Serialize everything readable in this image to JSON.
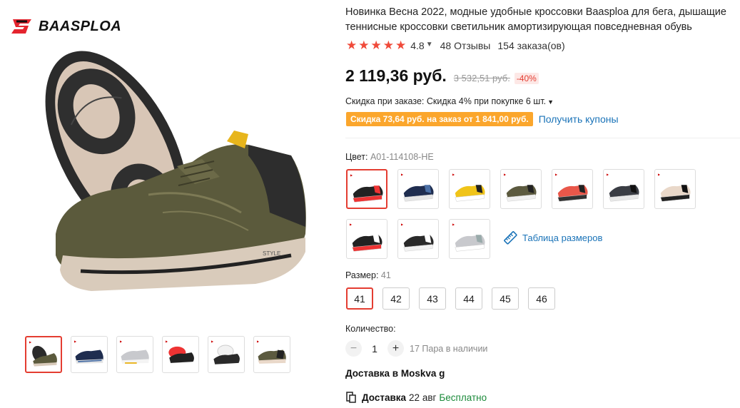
{
  "brand": {
    "name": "BAASPLOA"
  },
  "product": {
    "title": "Новинка Весна 2022, модные удобные кроссовки Baasploa для бега, дышащие теннисные кроссовки светильник амортизирующая повседневная обувь",
    "rating": "4.8",
    "reviews": "48 Отзывы",
    "orders": "154 заказа(ов)",
    "price": "2 119,36 руб.",
    "old_price": "3 532,51 руб.",
    "discount": "-40%",
    "order_discount": "Скидка при заказе: Скидка 4% при покупке 6 шт.",
    "coupon_badge": "Скидка 73,64 руб. на заказ от 1 841,00 руб.",
    "coupon_link": "Получить купоны"
  },
  "gallery": {
    "thumbs": [
      {
        "name": "olive"
      },
      {
        "name": "navy"
      },
      {
        "name": "grey"
      },
      {
        "name": "black-red"
      },
      {
        "name": "black-white"
      },
      {
        "name": "olive-2"
      }
    ]
  },
  "color": {
    "label": "Цвет:",
    "selected": "A01-114108-HE",
    "swatches": [
      {
        "name": "black-red",
        "upper": "#222",
        "sole": "#e33",
        "accent": "#e33"
      },
      {
        "name": "navy",
        "upper": "#1f2d4f",
        "sole": "#e6e6e6",
        "accent": "#4a6fa5"
      },
      {
        "name": "yellow",
        "upper": "#f0c419",
        "sole": "#fff",
        "accent": "#222"
      },
      {
        "name": "olive",
        "upper": "#5c5a3f",
        "sole": "#f0f0f0",
        "accent": "#222"
      },
      {
        "name": "coral",
        "upper": "#e9574a",
        "sole": "#333",
        "accent": "#222"
      },
      {
        "name": "dark-grey",
        "upper": "#3a3d44",
        "sole": "#e8e8e8",
        "accent": "#111"
      },
      {
        "name": "beige",
        "upper": "#e9d8c9",
        "sole": "#222",
        "accent": "#111"
      },
      {
        "name": "black-white-red",
        "upper": "#222",
        "sole": "#e33",
        "accent": "#fff"
      },
      {
        "name": "black-white",
        "upper": "#2a2a2a",
        "sole": "#f2f2f2",
        "accent": "#fff"
      },
      {
        "name": "light-grey",
        "upper": "#c8c9cd",
        "sole": "#fff",
        "accent": "#9aa"
      }
    ],
    "size_chart": "Таблица размеров"
  },
  "size": {
    "label": "Размер:",
    "selected": "41",
    "options": [
      "41",
      "42",
      "43",
      "44",
      "45",
      "46"
    ]
  },
  "quantity": {
    "label": "Количество:",
    "value": "1",
    "minus": "−",
    "plus": "+",
    "stock": "17 Пара в наличии"
  },
  "delivery": {
    "title": "Доставка в Moskva g",
    "label": "Доставка",
    "date": "22 авг",
    "price": "Бесплатно"
  },
  "colors": {
    "accent": "#e43d31",
    "link": "#1a73b8",
    "coupon": "#fba62c",
    "star": "#f04a3a",
    "free": "#1b8a3a"
  }
}
